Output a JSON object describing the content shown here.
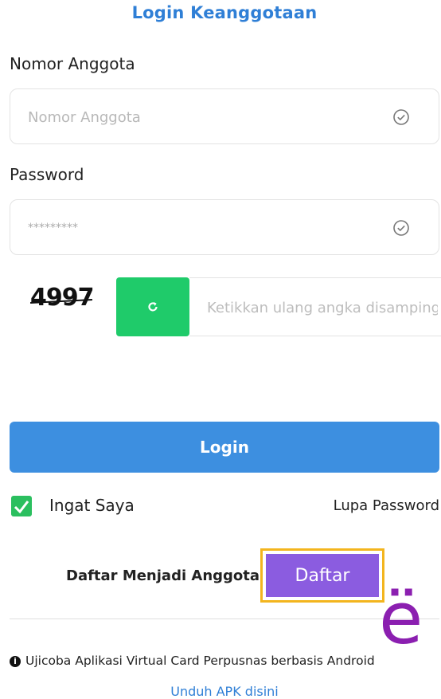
{
  "page": {
    "title": "Login Keanggotaan"
  },
  "form": {
    "member_label": "Nomor Anggota",
    "member_placeholder": "Nomor Anggota",
    "password_label": "Password",
    "password_value": "*********",
    "captcha_code": "4997",
    "captcha_refresh_icon": "refresh-icon",
    "captcha_placeholder": "Ketikkan ulang angka disamping",
    "login_button": "Login",
    "remember_label": "Ingat Saya",
    "remember_checked": true,
    "forgot_password": "Lupa Password"
  },
  "register": {
    "text": "Daftar Menjadi Anggota",
    "button": "Daftar"
  },
  "overlay": {
    "glyph": "ë"
  },
  "footer": {
    "info_icon": "info-icon",
    "info_text": "Ujicoba Aplikasi Virtual Card Perpusnas berbasis Android",
    "apk_link": "Unduh APK disini"
  },
  "colors": {
    "accent_blue": "#3d8fe0",
    "title_blue": "#2f7fd6",
    "refresh_green": "#1fcb6a",
    "register_purple": "#8b5ce0",
    "highlight_border": "#f3b51e",
    "overlay_purple": "#8b1fb0"
  }
}
